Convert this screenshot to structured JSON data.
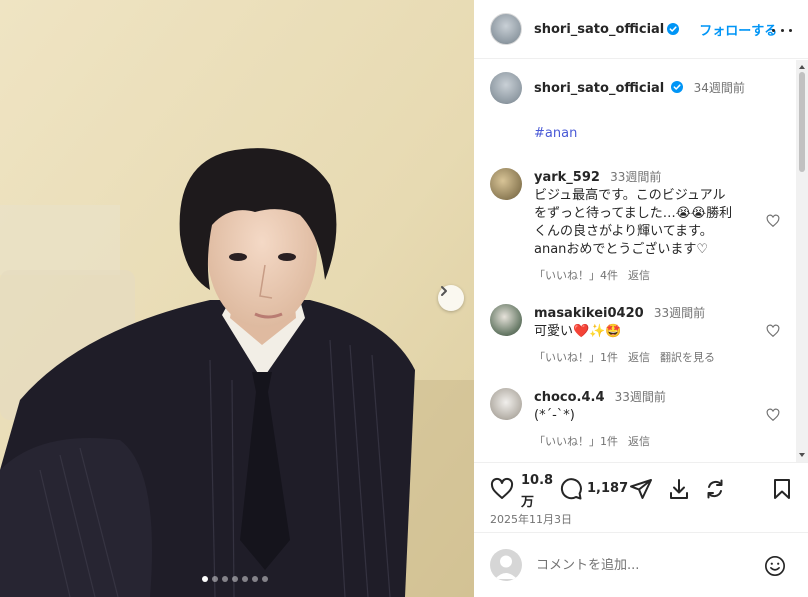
{
  "post": {
    "username": "shori_sato_official",
    "follow_label": "フォローする",
    "caption_time": "34週間前",
    "hashtag": "#anan",
    "like_count_line1": "10.8",
    "like_count_line2": "万",
    "comment_count": "1,187",
    "date": "2025年11月3日",
    "carousel": {
      "total": 7,
      "active_index": 0
    }
  },
  "comments": [
    {
      "username": "yark_592",
      "time": "33週間前",
      "text": "ビジュ最高です。このビジュアル\nをずっと待ってました…😭😭勝利\nくんの良さがより輝いてます。\nananおめでとうございます♡",
      "likes": "「いいね！」4件",
      "reply": "返信",
      "translate": ""
    },
    {
      "username": "masakikei0420",
      "time": "33週間前",
      "text": "可愛い❤️✨🤩",
      "likes": "「いいね！」1件",
      "reply": "返信",
      "translate": "翻訳を見る"
    },
    {
      "username": "choco.4.4",
      "time": "33週間前",
      "text": "(*´-`*)",
      "likes": "「いいね！」1件",
      "reply": "返信",
      "translate": ""
    }
  ],
  "add_comment": {
    "placeholder": "コメントを追加..."
  },
  "icons": {
    "verified": "verified-badge-icon",
    "more": "more-options-icon",
    "next": "chevron-right-icon",
    "like": "heart-icon",
    "comment": "comment-bubble-icon",
    "share": "paper-plane-icon",
    "download": "download-icon",
    "remix": "remix-icon",
    "save": "bookmark-icon",
    "emoji": "emoji-icon"
  },
  "colors": {
    "accent": "#0095f6",
    "verified": "#0095f6",
    "hashtag": "#4a5ad6",
    "muted": "#737373"
  }
}
